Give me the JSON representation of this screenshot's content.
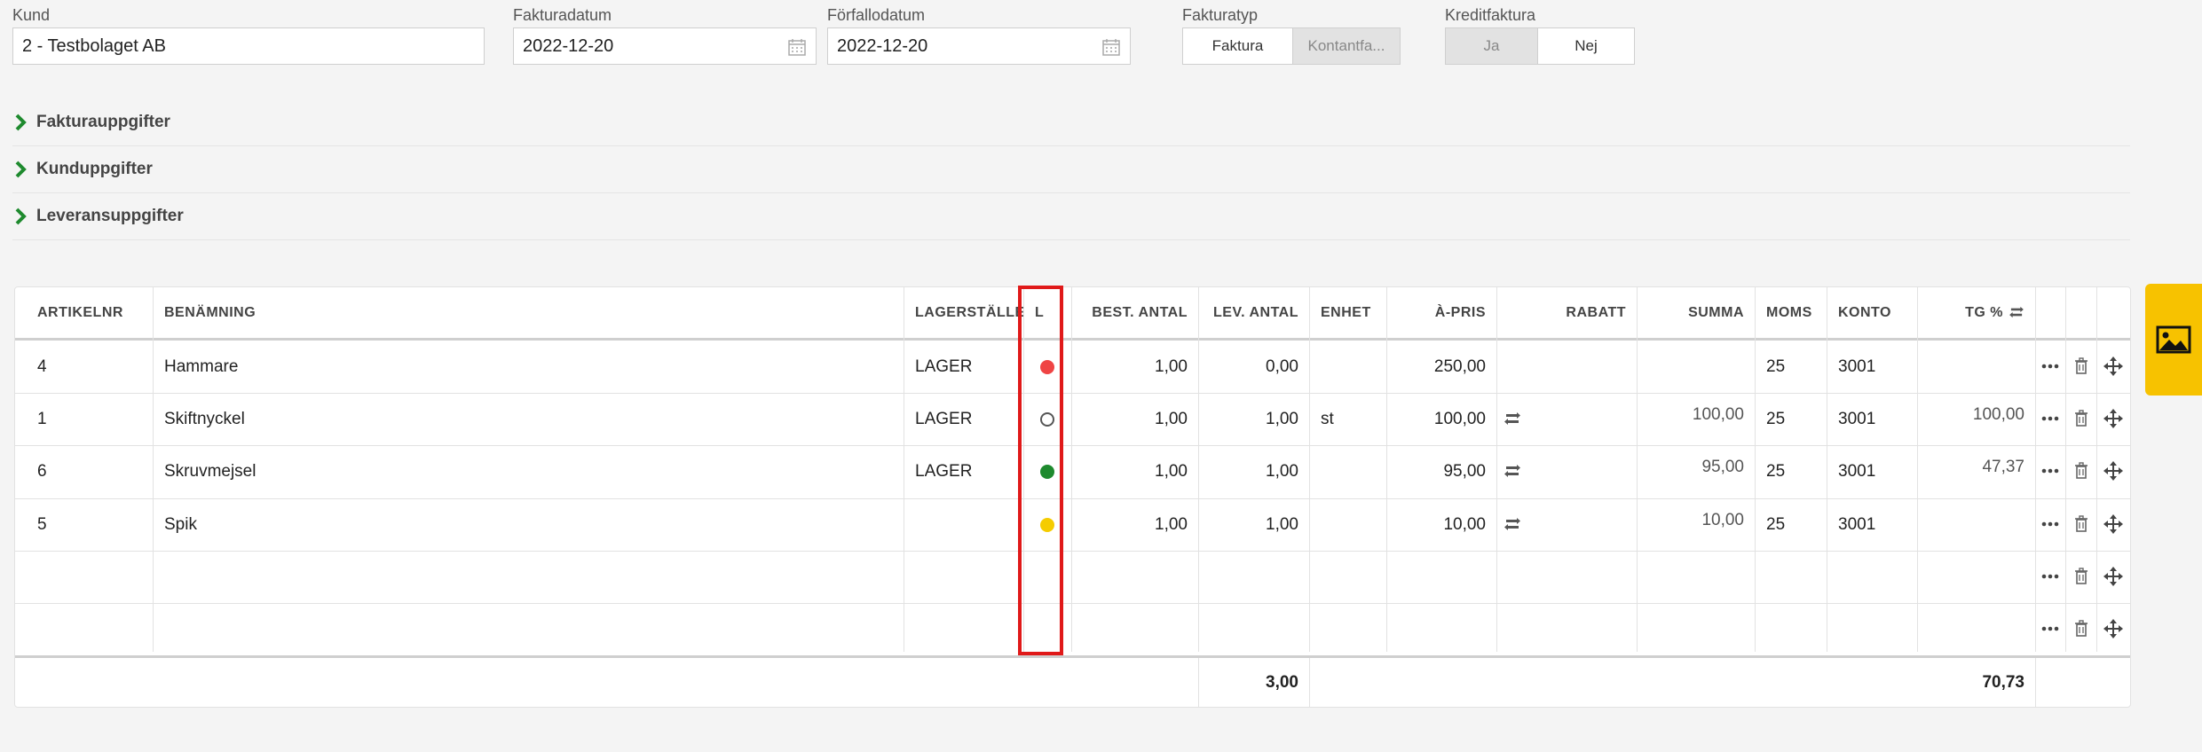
{
  "fields": {
    "kund": {
      "label": "Kund",
      "value": "2 - Testbolaget AB"
    },
    "fakturadatum": {
      "label": "Fakturadatum",
      "value": "2022-12-20"
    },
    "forfallodatum": {
      "label": "Förfallodatum",
      "value": "2022-12-20"
    },
    "fakturatyp": {
      "label": "Fakturatyp",
      "options": [
        "Faktura",
        "Kontantfa..."
      ],
      "selected": "Faktura"
    },
    "kreditfaktura": {
      "label": "Kreditfaktura",
      "options": [
        "Ja",
        "Nej"
      ],
      "selected": "Nej"
    }
  },
  "sections": [
    "Fakturauppgifter",
    "Kunduppgifter",
    "Leveransuppgifter"
  ],
  "table": {
    "columns": [
      "ARTIKELNR",
      "BENÄMNING",
      "LAGERSTÄLLE",
      "L",
      "BEST. ANTAL",
      "LEV. ANTAL",
      "ENHET",
      "À-PRIS",
      "RABATT",
      "SUMMA",
      "MOMS",
      "KONTO",
      "TG %"
    ],
    "rows": [
      {
        "artikelnr": "4",
        "benamning": "Hammare",
        "lager": "LAGER",
        "status": "red",
        "best": "1,00",
        "lev": "0,00",
        "enhet": "",
        "apris": "250,00",
        "rabatt_icon": false,
        "summa": "",
        "moms": "25",
        "konto": "3001",
        "tg": ""
      },
      {
        "artikelnr": "1",
        "benamning": "Skiftnyckel",
        "lager": "LAGER",
        "status": "empty",
        "best": "1,00",
        "lev": "1,00",
        "enhet": "st",
        "apris": "100,00",
        "rabatt_icon": true,
        "summa": "100,00",
        "moms": "25",
        "konto": "3001",
        "tg": "100,00"
      },
      {
        "artikelnr": "6",
        "benamning": "Skruvmejsel",
        "lager": "LAGER",
        "status": "green",
        "best": "1,00",
        "lev": "1,00",
        "enhet": "",
        "apris": "95,00",
        "rabatt_icon": true,
        "summa": "95,00",
        "moms": "25",
        "konto": "3001",
        "tg": "47,37"
      },
      {
        "artikelnr": "5",
        "benamning": "Spik",
        "lager": "",
        "status": "yellow",
        "best": "1,00",
        "lev": "1,00",
        "enhet": "",
        "apris": "10,00",
        "rabatt_icon": true,
        "summa": "10,00",
        "moms": "25",
        "konto": "3001",
        "tg": ""
      }
    ],
    "footer": {
      "lev_total": "3,00",
      "tg_total": "70,73"
    }
  },
  "colors": {
    "red": "#ef4444",
    "green": "#1e8a2e",
    "yellow": "#f5cc00",
    "highlight": "#e01919",
    "accent": "#f7c200",
    "chevron": "#1e8a2e"
  },
  "icons": {
    "calendar": "calendar-icon",
    "chevron": "chevron-right-icon",
    "refresh": "refresh-icon",
    "more": "more-icon",
    "trash": "trash-icon",
    "move": "move-icon",
    "image": "image-icon"
  }
}
